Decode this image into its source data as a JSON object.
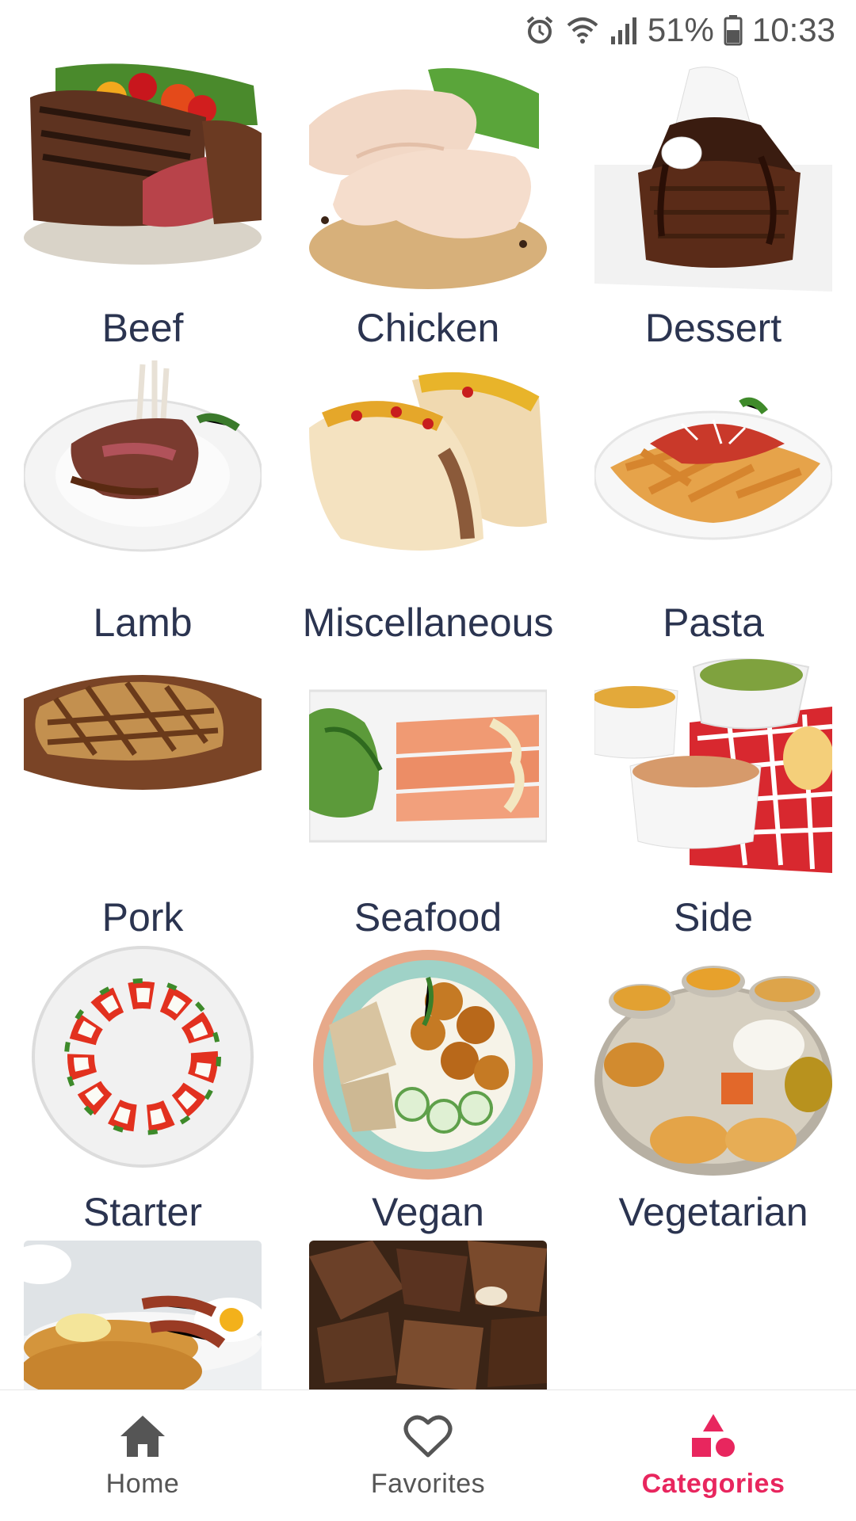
{
  "status_bar": {
    "battery": "51%",
    "time": "10:33",
    "icons": [
      "alarm-icon",
      "wifi-icon",
      "signal-icon",
      "battery-icon"
    ]
  },
  "categories": [
    {
      "name": "Beef",
      "icon": "beef-photo"
    },
    {
      "name": "Chicken",
      "icon": "chicken-photo"
    },
    {
      "name": "Dessert",
      "icon": "dessert-photo"
    },
    {
      "name": "Lamb",
      "icon": "lamb-photo"
    },
    {
      "name": "Miscellaneous",
      "icon": "tacos-photo"
    },
    {
      "name": "Pasta",
      "icon": "pasta-photo"
    },
    {
      "name": "Pork",
      "icon": "pork-photo"
    },
    {
      "name": "Seafood",
      "icon": "salmon-photo"
    },
    {
      "name": "Side",
      "icon": "sides-photo"
    },
    {
      "name": "Starter",
      "icon": "caprese-photo"
    },
    {
      "name": "Vegan",
      "icon": "falafel-bowl-photo"
    },
    {
      "name": "Vegetarian",
      "icon": "thali-photo"
    },
    {
      "name": "",
      "icon": "breakfast-photo"
    },
    {
      "name": "",
      "icon": "goat-meat-photo"
    }
  ],
  "bottom_nav": {
    "items": [
      {
        "label": "Home",
        "icon": "home-icon",
        "active": false
      },
      {
        "label": "Favorites",
        "icon": "heart-icon",
        "active": false
      },
      {
        "label": "Categories",
        "icon": "categories-icon",
        "active": true
      }
    ]
  },
  "colors": {
    "label_text": "#2b3450",
    "accent": "#e8265e",
    "nav_inactive": "#555555"
  }
}
